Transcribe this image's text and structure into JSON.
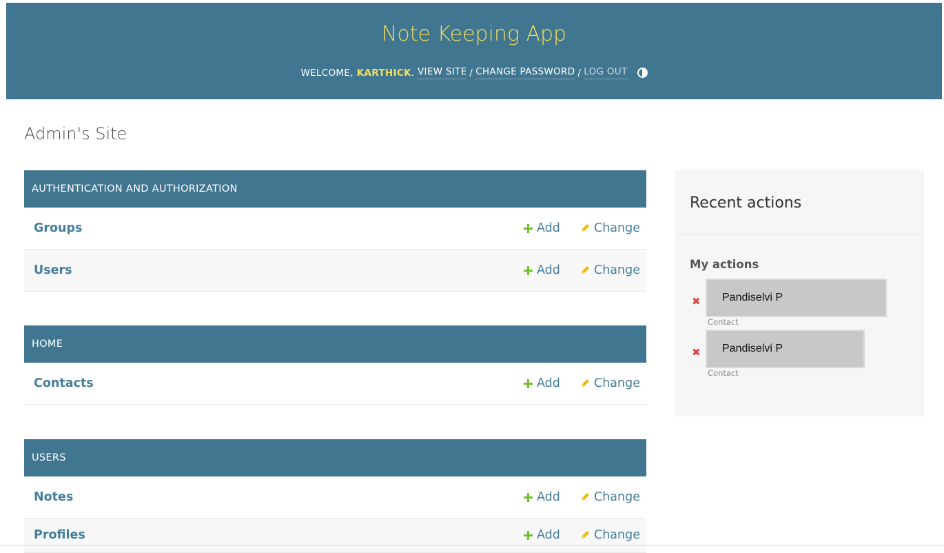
{
  "header": {
    "branding": "Note Keeping App",
    "welcome": "WELCOME,",
    "username": "KARTHICK",
    "view_site": "VIEW SITE",
    "change_password": "CHANGE PASSWORD",
    "log_out": "LOG OUT",
    "separator": "/"
  },
  "site_title": "Admin's Site",
  "modules": [
    {
      "caption": "AUTHENTICATION AND AUTHORIZATION",
      "rows": [
        {
          "name": "Groups",
          "add": "Add",
          "change": "Change"
        },
        {
          "name": "Users",
          "add": "Add",
          "change": "Change"
        }
      ]
    },
    {
      "caption": "HOME",
      "rows": [
        {
          "name": "Contacts",
          "add": "Add",
          "change": "Change"
        }
      ]
    },
    {
      "caption": "USERS",
      "rows": [
        {
          "name": "Notes",
          "add": "Add",
          "change": "Change"
        },
        {
          "name": "Profiles",
          "add": "Add",
          "change": "Change"
        }
      ]
    }
  ],
  "recent_actions": {
    "title": "Recent actions",
    "subtitle": "My actions",
    "items": [
      {
        "name": "Pandiselvi P",
        "type": "Contact",
        "icon": "delete-icon"
      },
      {
        "name": "Pandiselvi P",
        "type": "Contact",
        "icon": "delete-icon"
      }
    ]
  },
  "colors": {
    "header_bg": "#417690",
    "branding": "#f5dd5d",
    "link": "#447e9b",
    "add_icon": "#70bf2b",
    "change_icon": "#efb80b",
    "delete_icon": "#dd4646"
  }
}
